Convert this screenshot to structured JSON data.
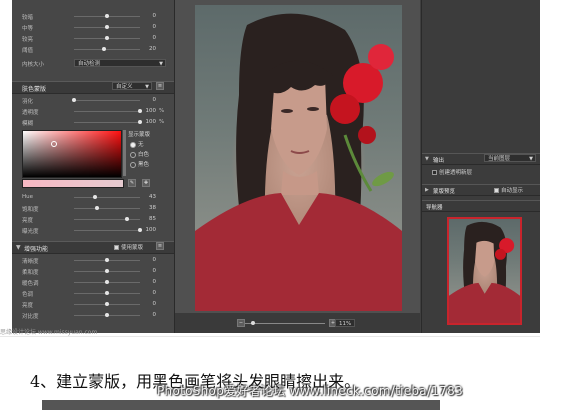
{
  "top_section": {
    "rows": [
      {
        "label": "较暗",
        "value": "0",
        "knob": 0.5
      },
      {
        "label": "中等",
        "value": "0",
        "knob": 0.5
      },
      {
        "label": "较亮",
        "value": "0",
        "knob": 0.5
      },
      {
        "label": "阈值",
        "value": "20",
        "knob": 0.45
      }
    ],
    "size_label": "内核大小",
    "size_value": "自动检测"
  },
  "skin_mask": {
    "title": "肤色蒙版",
    "preset": "自定义",
    "rows": [
      {
        "label": "羽化",
        "value": "0",
        "unit": "",
        "knob": 0.0
      },
      {
        "label": "透明度",
        "value": "100",
        "unit": "%",
        "knob": 1.0
      },
      {
        "label": "模糊",
        "value": "100",
        "unit": "%",
        "knob": 1.0
      }
    ],
    "display_label": "显示蒙版",
    "display_options": [
      {
        "label": "无",
        "selected": true
      },
      {
        "label": "白色",
        "selected": false
      },
      {
        "label": "黑色",
        "selected": false
      }
    ],
    "hsl_rows": [
      {
        "label": "Hue",
        "value": "43",
        "unit": "",
        "knob": 0.32
      },
      {
        "label": "饱和度",
        "value": "38",
        "unit": "",
        "knob": 0.35
      },
      {
        "label": "亮度",
        "value": "85",
        "unit": "",
        "knob": 0.8
      },
      {
        "label": "曝光度",
        "value": "100",
        "unit": "",
        "knob": 1.0
      }
    ]
  },
  "beauty_section": {
    "title": "增强功能",
    "use_mask_label": "使用蒙版",
    "use_mask_checked": true,
    "rows": [
      {
        "label": "清晰度",
        "value": "0",
        "knob": 0.5
      },
      {
        "label": "柔和度",
        "value": "0",
        "knob": 0.5
      },
      {
        "label": "暖色调",
        "value": "0",
        "knob": 0.5
      },
      {
        "label": "色调",
        "value": "0",
        "knob": 0.5
      },
      {
        "label": "亮度",
        "value": "0",
        "knob": 0.5
      },
      {
        "label": "对比度",
        "value": "0",
        "knob": 0.5
      }
    ]
  },
  "right_panel": {
    "output_title": "输出",
    "output_mode": "当前图层",
    "new_layer_label": "创建透明新层",
    "preview_title": "蒙版预览",
    "auto_show_label": "自动显示",
    "auto_show_checked": true,
    "navigator_title": "导航器"
  },
  "bottom_bar": {
    "zoom_value": "11%",
    "zoom_level": 0.1
  },
  "caption": {
    "step_text": "4、建立蒙版，用黑色画笔将头发眼睛擦出来。",
    "watermark": "PhotoShop爱好者论坛   www.lineck.com/tieba/1783",
    "site_mark": "思缘设计论坛  www.missyuan.com"
  },
  "colors": {
    "accent_red": "#d81a2a",
    "panel_bg": "#474747",
    "app_bg": "#3f3f3f"
  }
}
